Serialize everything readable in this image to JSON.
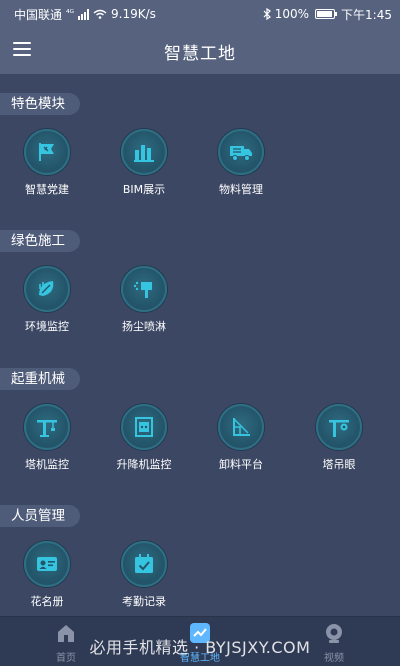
{
  "status_bar": {
    "carrier": "中国联通",
    "network_type": "⁴ᴳ",
    "speed": "9.19K/s",
    "battery": "100%",
    "time": "下午1:45"
  },
  "header": {
    "title": "智慧工地"
  },
  "sections": [
    {
      "label": "特色模块",
      "items": [
        {
          "label": "智慧党建",
          "icon": "party-flag-icon"
        },
        {
          "label": "BIM展示",
          "icon": "bim-building-icon"
        },
        {
          "label": "物料管理",
          "icon": "truck-icon"
        }
      ]
    },
    {
      "label": "绿色施工",
      "items": [
        {
          "label": "环境监控",
          "icon": "leaf-monitor-icon"
        },
        {
          "label": "扬尘喷淋",
          "icon": "spray-icon"
        }
      ]
    },
    {
      "label": "起重机械",
      "items": [
        {
          "label": "塔机监控",
          "icon": "tower-crane-icon"
        },
        {
          "label": "升降机监控",
          "icon": "elevator-icon"
        },
        {
          "label": "卸料平台",
          "icon": "unloading-platform-icon"
        },
        {
          "label": "塔吊眼",
          "icon": "crane-camera-icon"
        }
      ]
    },
    {
      "label": "人员管理",
      "items": [
        {
          "label": "花名册",
          "icon": "id-card-icon"
        },
        {
          "label": "考勤记录",
          "icon": "attendance-calendar-icon"
        }
      ]
    }
  ],
  "bottom_nav": [
    {
      "label": "首页",
      "icon": "home-icon",
      "active": false
    },
    {
      "label": "智慧工地",
      "icon": "smart-site-icon",
      "active": true
    },
    {
      "label": "视频",
      "icon": "camera-icon",
      "active": false
    }
  ],
  "watermark": "必用手机精选 · BYJSJXY.COM",
  "colors": {
    "background": "#3b4763",
    "header": "#56627e",
    "icon_fill": "#24566b",
    "icon_glyph": "#35c5e0",
    "active_nav": "#5fb7ff"
  }
}
